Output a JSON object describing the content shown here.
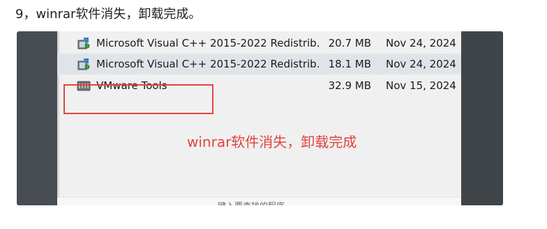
{
  "article": {
    "step_heading": "9，winrar软件消失，卸载完成。"
  },
  "screenshot": {
    "programs": [
      {
        "name": "Microsoft Visual C++ 2015-2022 Redistrib...",
        "size": "20.7 MB",
        "date": "Nov 24, 2024",
        "icon": "installer-package-icon"
      },
      {
        "name": "Microsoft Visual C++ 2015-2022 Redistrib...",
        "size": "18.1 MB",
        "date": "Nov 24, 2024",
        "icon": "installer-package-icon"
      },
      {
        "name": "VMware Tools",
        "size": "32.9 MB",
        "date": "Nov 15, 2024",
        "icon": "vmware-icon"
      }
    ],
    "annotation": "winrar软件消失，卸载完成",
    "annotation_color": "#e0453f",
    "bottom_hint": "键入要查找的程序"
  }
}
